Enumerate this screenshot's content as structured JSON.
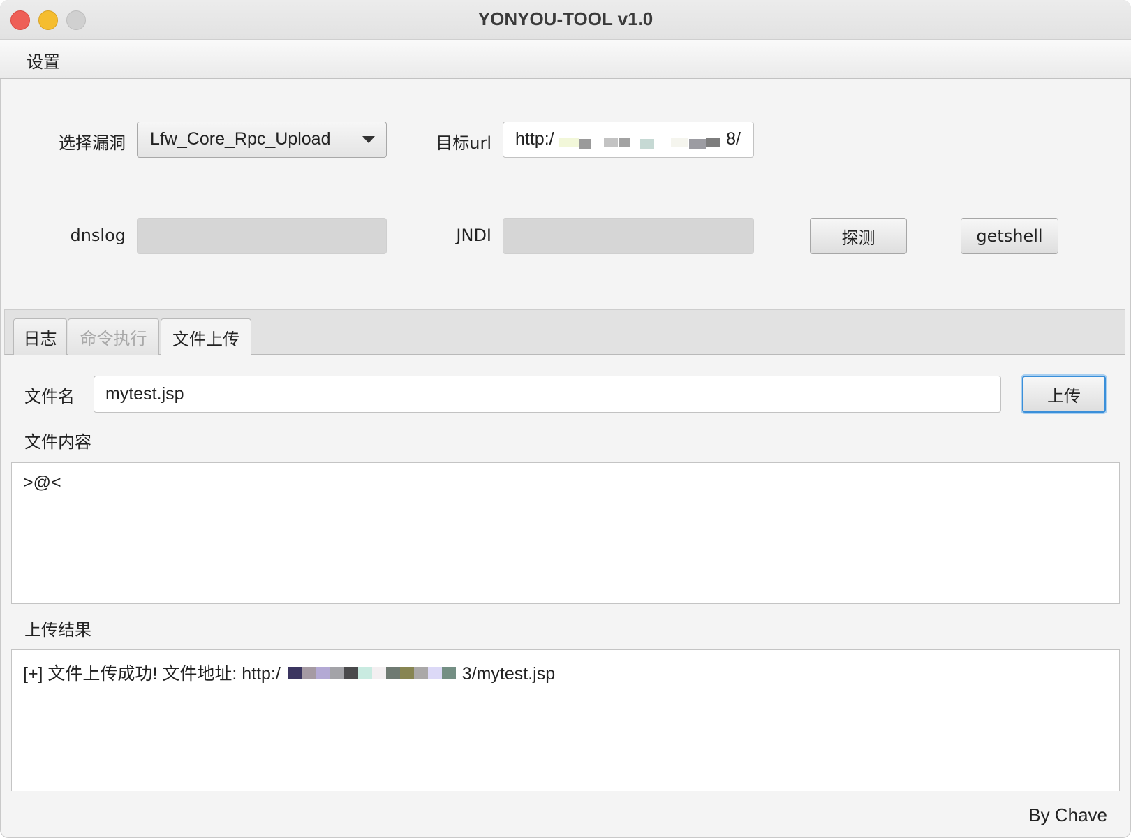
{
  "window": {
    "title": "YONYOU-TOOL v1.0"
  },
  "menu": {
    "items": [
      "设置"
    ]
  },
  "form": {
    "vuln_label": "选择漏洞",
    "vuln_selected": "Lfw_Core_Rpc_Upload",
    "url_label": "目标url",
    "url_value_start": "http:/",
    "url_value_end": ")88/",
    "dnslog_label": "dnslog",
    "dnslog_value": "",
    "jndi_label": "JNDI",
    "jndi_value": "",
    "detect_button": "探测",
    "getshell_button": "getshell"
  },
  "tabs": [
    {
      "label": "日志",
      "state": "normal"
    },
    {
      "label": "命令执行",
      "state": "disabled"
    },
    {
      "label": "文件上传",
      "state": "active"
    }
  ],
  "upload": {
    "filename_label": "文件名",
    "filename_value": "mytest.jsp",
    "upload_button": "上传",
    "content_label": "文件内容",
    "content_value": ">@<",
    "result_label": "上传结果",
    "result_prefix": "[+] 文件上传成功! 文件地址: http:/",
    "result_suffix": "3/mytest.jsp"
  },
  "footer": {
    "credit": "By Chave"
  },
  "colors": {
    "close": "#ee5f57",
    "minimize": "#f5bd2f",
    "zoom": "#d0d0d0",
    "focus_ring": "#3a8fd9"
  }
}
